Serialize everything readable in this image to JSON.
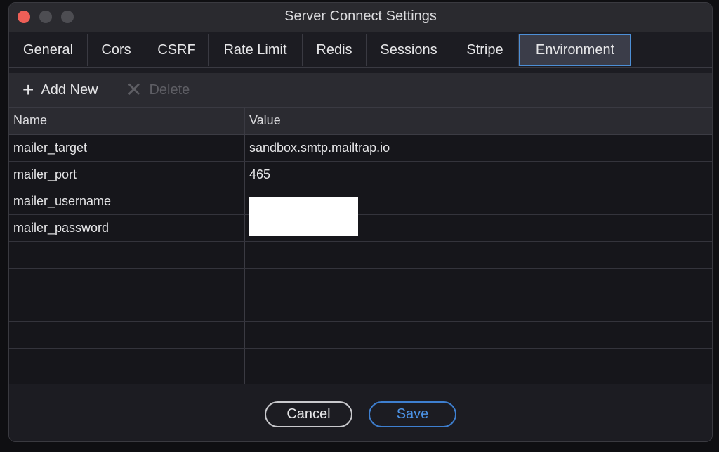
{
  "window": {
    "title": "Server Connect Settings"
  },
  "tabs": [
    {
      "label": "General"
    },
    {
      "label": "Cors"
    },
    {
      "label": "CSRF"
    },
    {
      "label": "Rate Limit"
    },
    {
      "label": "Redis"
    },
    {
      "label": "Sessions"
    },
    {
      "label": "Stripe"
    },
    {
      "label": "Environment",
      "active": true
    }
  ],
  "toolbar": {
    "add_label": "Add New",
    "delete_label": "Delete"
  },
  "grid": {
    "columns": [
      "Name",
      "Value"
    ],
    "rows": [
      {
        "name": "mailer_target",
        "value": "sandbox.smtp.mailtrap.io"
      },
      {
        "name": "mailer_port",
        "value": "465"
      },
      {
        "name": "mailer_username",
        "value": ""
      },
      {
        "name": "mailer_password",
        "value": ""
      }
    ]
  },
  "footer": {
    "cancel_label": "Cancel",
    "save_label": "Save"
  },
  "colors": {
    "accent": "#4d8fd6",
    "close": "#ee5f57"
  }
}
